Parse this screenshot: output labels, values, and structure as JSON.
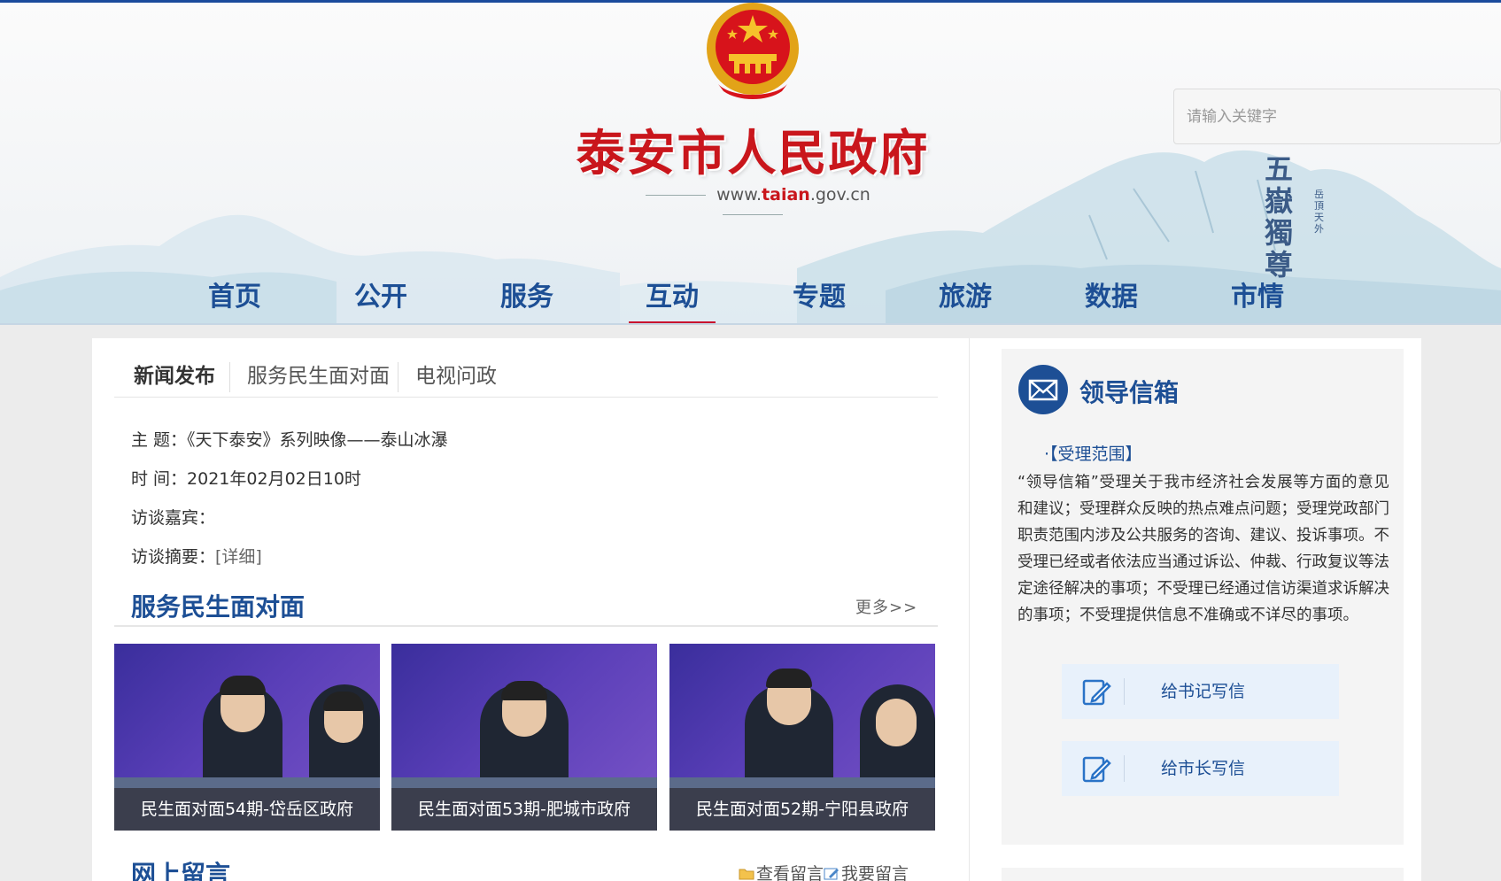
{
  "header": {
    "site_title": "泰安市人民政府",
    "site_url_prefix": "www.",
    "site_url_domain": "taian",
    "site_url_suffix": ".gov.cn",
    "calligraphy": "五嶽獨尊",
    "calligraphy_small": "岳頂天外",
    "search_placeholder": "请输入关键字"
  },
  "nav": {
    "items": [
      {
        "label": "首页"
      },
      {
        "label": "公开"
      },
      {
        "label": "服务"
      },
      {
        "label": "互动",
        "active": true
      },
      {
        "label": "专题"
      },
      {
        "label": "旅游"
      },
      {
        "label": "数据"
      },
      {
        "label": "市情"
      }
    ]
  },
  "main": {
    "tabs": [
      {
        "label": "新闻发布",
        "active": true
      },
      {
        "label": "服务民生面对面"
      },
      {
        "label": "电视问政"
      }
    ],
    "news": {
      "subject_key": "主 题：",
      "subject_value": "《天下泰安》系列映像——泰山冰瀑",
      "time_key": "时 间：",
      "time_value": "2021年02月02日10时",
      "guest_key": "访谈嘉宾：",
      "guest_value": "",
      "summary_key": "访谈摘要：",
      "summary_link": "[详细]"
    },
    "face_section": {
      "title": "服务民生面对面",
      "more": "更多>>",
      "cards": [
        {
          "caption": "民生面对面54期-岱岳区政府"
        },
        {
          "caption": "民生面对面53期-肥城市政府"
        },
        {
          "caption": "民生面对面52期-宁阳县政府"
        }
      ]
    },
    "message_section": {
      "title": "网上留言",
      "view_label": "查看留言",
      "write_label": "我要留言"
    }
  },
  "sidebar": {
    "title": "领导信箱",
    "subhead": "·【受理范围】",
    "text": "“领导信箱”受理关于我市经济社会发展等方面的意见和建议；受理群众反映的热点难点问题；受理党政部门职责范围内涉及公共服务的咨询、建议、投诉事项。不受理已经或者依法应当通过诉讼、仲裁、行政复议等法定途径解决的事项；不受理已经通过信访渠道求诉解决的事项；不受理提供信息不准确或不详尽的事项。",
    "buttons": [
      {
        "label": "给书记写信"
      },
      {
        "label": "给市长写信"
      }
    ]
  },
  "colors": {
    "brand_blue": "#1d4f95",
    "title_red": "#c9161c",
    "active_red": "#c8102e"
  }
}
